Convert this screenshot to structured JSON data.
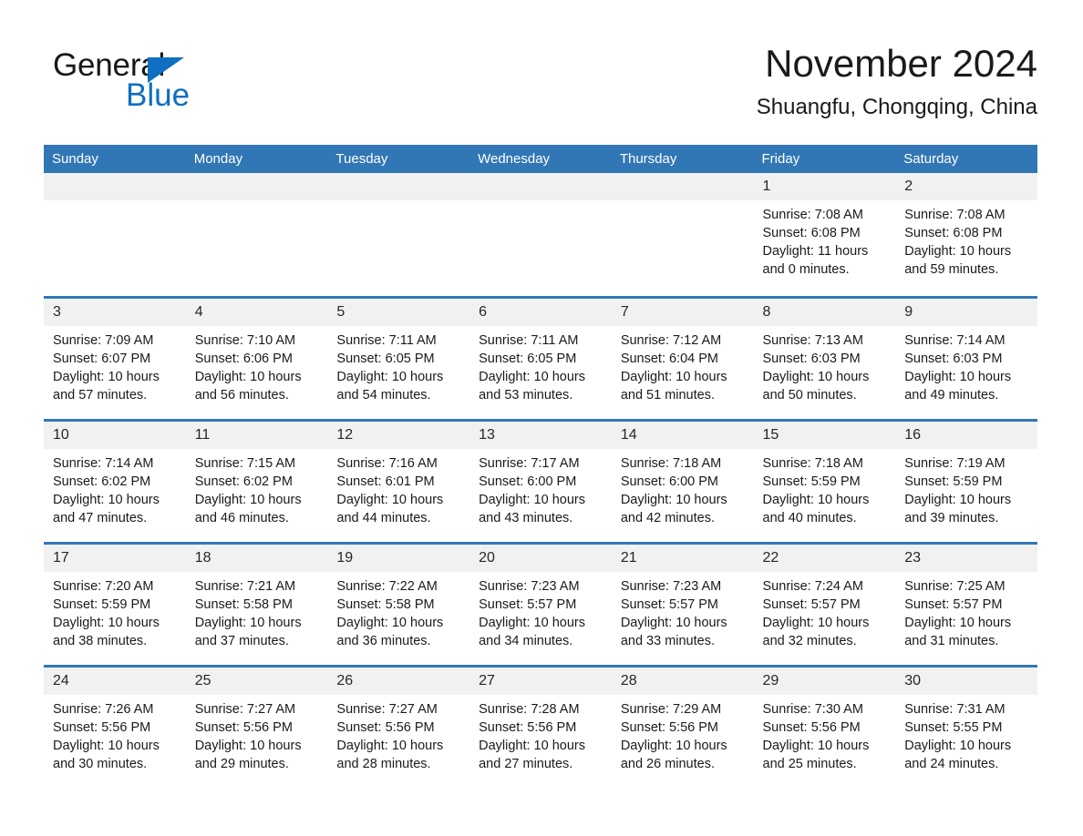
{
  "brand": {
    "name_part1": "General",
    "name_part2": "Blue",
    "accent_color": "#0f6fc0"
  },
  "header": {
    "title": "November 2024",
    "subtitle": "Shuangfu, Chongqing, China"
  },
  "theme": {
    "header_bar_color": "#3277b5",
    "daynum_strip_color": "#f1f1f1",
    "divider_color": "#3277b5"
  },
  "calendar": {
    "weekday_headers": [
      "Sunday",
      "Monday",
      "Tuesday",
      "Wednesday",
      "Thursday",
      "Friday",
      "Saturday"
    ],
    "weeks": [
      [
        {
          "day": "",
          "empty": true
        },
        {
          "day": "",
          "empty": true
        },
        {
          "day": "",
          "empty": true
        },
        {
          "day": "",
          "empty": true
        },
        {
          "day": "",
          "empty": true
        },
        {
          "day": "1",
          "sunrise": "Sunrise: 7:08 AM",
          "sunset": "Sunset: 6:08 PM",
          "daylight": "Daylight: 11 hours and 0 minutes."
        },
        {
          "day": "2",
          "sunrise": "Sunrise: 7:08 AM",
          "sunset": "Sunset: 6:08 PM",
          "daylight": "Daylight: 10 hours and 59 minutes."
        }
      ],
      [
        {
          "day": "3",
          "sunrise": "Sunrise: 7:09 AM",
          "sunset": "Sunset: 6:07 PM",
          "daylight": "Daylight: 10 hours and 57 minutes."
        },
        {
          "day": "4",
          "sunrise": "Sunrise: 7:10 AM",
          "sunset": "Sunset: 6:06 PM",
          "daylight": "Daylight: 10 hours and 56 minutes."
        },
        {
          "day": "5",
          "sunrise": "Sunrise: 7:11 AM",
          "sunset": "Sunset: 6:05 PM",
          "daylight": "Daylight: 10 hours and 54 minutes."
        },
        {
          "day": "6",
          "sunrise": "Sunrise: 7:11 AM",
          "sunset": "Sunset: 6:05 PM",
          "daylight": "Daylight: 10 hours and 53 minutes."
        },
        {
          "day": "7",
          "sunrise": "Sunrise: 7:12 AM",
          "sunset": "Sunset: 6:04 PM",
          "daylight": "Daylight: 10 hours and 51 minutes."
        },
        {
          "day": "8",
          "sunrise": "Sunrise: 7:13 AM",
          "sunset": "Sunset: 6:03 PM",
          "daylight": "Daylight: 10 hours and 50 minutes."
        },
        {
          "day": "9",
          "sunrise": "Sunrise: 7:14 AM",
          "sunset": "Sunset: 6:03 PM",
          "daylight": "Daylight: 10 hours and 49 minutes."
        }
      ],
      [
        {
          "day": "10",
          "sunrise": "Sunrise: 7:14 AM",
          "sunset": "Sunset: 6:02 PM",
          "daylight": "Daylight: 10 hours and 47 minutes."
        },
        {
          "day": "11",
          "sunrise": "Sunrise: 7:15 AM",
          "sunset": "Sunset: 6:02 PM",
          "daylight": "Daylight: 10 hours and 46 minutes."
        },
        {
          "day": "12",
          "sunrise": "Sunrise: 7:16 AM",
          "sunset": "Sunset: 6:01 PM",
          "daylight": "Daylight: 10 hours and 44 minutes."
        },
        {
          "day": "13",
          "sunrise": "Sunrise: 7:17 AM",
          "sunset": "Sunset: 6:00 PM",
          "daylight": "Daylight: 10 hours and 43 minutes."
        },
        {
          "day": "14",
          "sunrise": "Sunrise: 7:18 AM",
          "sunset": "Sunset: 6:00 PM",
          "daylight": "Daylight: 10 hours and 42 minutes."
        },
        {
          "day": "15",
          "sunrise": "Sunrise: 7:18 AM",
          "sunset": "Sunset: 5:59 PM",
          "daylight": "Daylight: 10 hours and 40 minutes."
        },
        {
          "day": "16",
          "sunrise": "Sunrise: 7:19 AM",
          "sunset": "Sunset: 5:59 PM",
          "daylight": "Daylight: 10 hours and 39 minutes."
        }
      ],
      [
        {
          "day": "17",
          "sunrise": "Sunrise: 7:20 AM",
          "sunset": "Sunset: 5:59 PM",
          "daylight": "Daylight: 10 hours and 38 minutes."
        },
        {
          "day": "18",
          "sunrise": "Sunrise: 7:21 AM",
          "sunset": "Sunset: 5:58 PM",
          "daylight": "Daylight: 10 hours and 37 minutes."
        },
        {
          "day": "19",
          "sunrise": "Sunrise: 7:22 AM",
          "sunset": "Sunset: 5:58 PM",
          "daylight": "Daylight: 10 hours and 36 minutes."
        },
        {
          "day": "20",
          "sunrise": "Sunrise: 7:23 AM",
          "sunset": "Sunset: 5:57 PM",
          "daylight": "Daylight: 10 hours and 34 minutes."
        },
        {
          "day": "21",
          "sunrise": "Sunrise: 7:23 AM",
          "sunset": "Sunset: 5:57 PM",
          "daylight": "Daylight: 10 hours and 33 minutes."
        },
        {
          "day": "22",
          "sunrise": "Sunrise: 7:24 AM",
          "sunset": "Sunset: 5:57 PM",
          "daylight": "Daylight: 10 hours and 32 minutes."
        },
        {
          "day": "23",
          "sunrise": "Sunrise: 7:25 AM",
          "sunset": "Sunset: 5:57 PM",
          "daylight": "Daylight: 10 hours and 31 minutes."
        }
      ],
      [
        {
          "day": "24",
          "sunrise": "Sunrise: 7:26 AM",
          "sunset": "Sunset: 5:56 PM",
          "daylight": "Daylight: 10 hours and 30 minutes."
        },
        {
          "day": "25",
          "sunrise": "Sunrise: 7:27 AM",
          "sunset": "Sunset: 5:56 PM",
          "daylight": "Daylight: 10 hours and 29 minutes."
        },
        {
          "day": "26",
          "sunrise": "Sunrise: 7:27 AM",
          "sunset": "Sunset: 5:56 PM",
          "daylight": "Daylight: 10 hours and 28 minutes."
        },
        {
          "day": "27",
          "sunrise": "Sunrise: 7:28 AM",
          "sunset": "Sunset: 5:56 PM",
          "daylight": "Daylight: 10 hours and 27 minutes."
        },
        {
          "day": "28",
          "sunrise": "Sunrise: 7:29 AM",
          "sunset": "Sunset: 5:56 PM",
          "daylight": "Daylight: 10 hours and 26 minutes."
        },
        {
          "day": "29",
          "sunrise": "Sunrise: 7:30 AM",
          "sunset": "Sunset: 5:56 PM",
          "daylight": "Daylight: 10 hours and 25 minutes."
        },
        {
          "day": "30",
          "sunrise": "Sunrise: 7:31 AM",
          "sunset": "Sunset: 5:55 PM",
          "daylight": "Daylight: 10 hours and 24 minutes."
        }
      ]
    ]
  }
}
